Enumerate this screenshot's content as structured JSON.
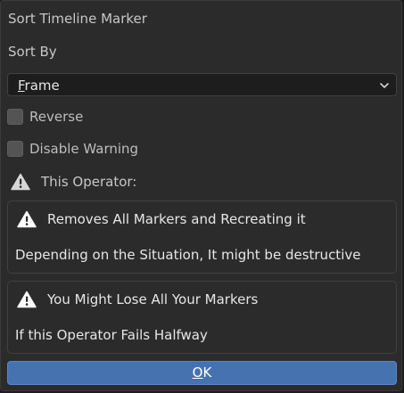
{
  "dialog": {
    "title": "Sort Timeline Marker",
    "sort_by_label": "Sort By",
    "sort_by_value_first": "F",
    "sort_by_value_rest": "rame",
    "options": [
      {
        "label": "Reverse",
        "checked": false
      },
      {
        "label": "Disable Warning",
        "checked": false
      }
    ],
    "operator_label": "This Operator:",
    "warnings": [
      {
        "heading": "Removes All Markers and Recreating it",
        "detail": "Depending on the Situation, It might be destructive"
      },
      {
        "heading": "You Might Lose All Your Markers",
        "detail": "If this Operator Fails Halfway"
      }
    ],
    "ok_first": "O",
    "ok_rest": "K"
  },
  "icons": {
    "dropdown": "chevron-down-icon",
    "warning": "warning-icon"
  },
  "colors": {
    "background": "#2b2b2b",
    "field": "#1d1d1d",
    "checkbox": "#545454",
    "accent": "#4672b0"
  }
}
